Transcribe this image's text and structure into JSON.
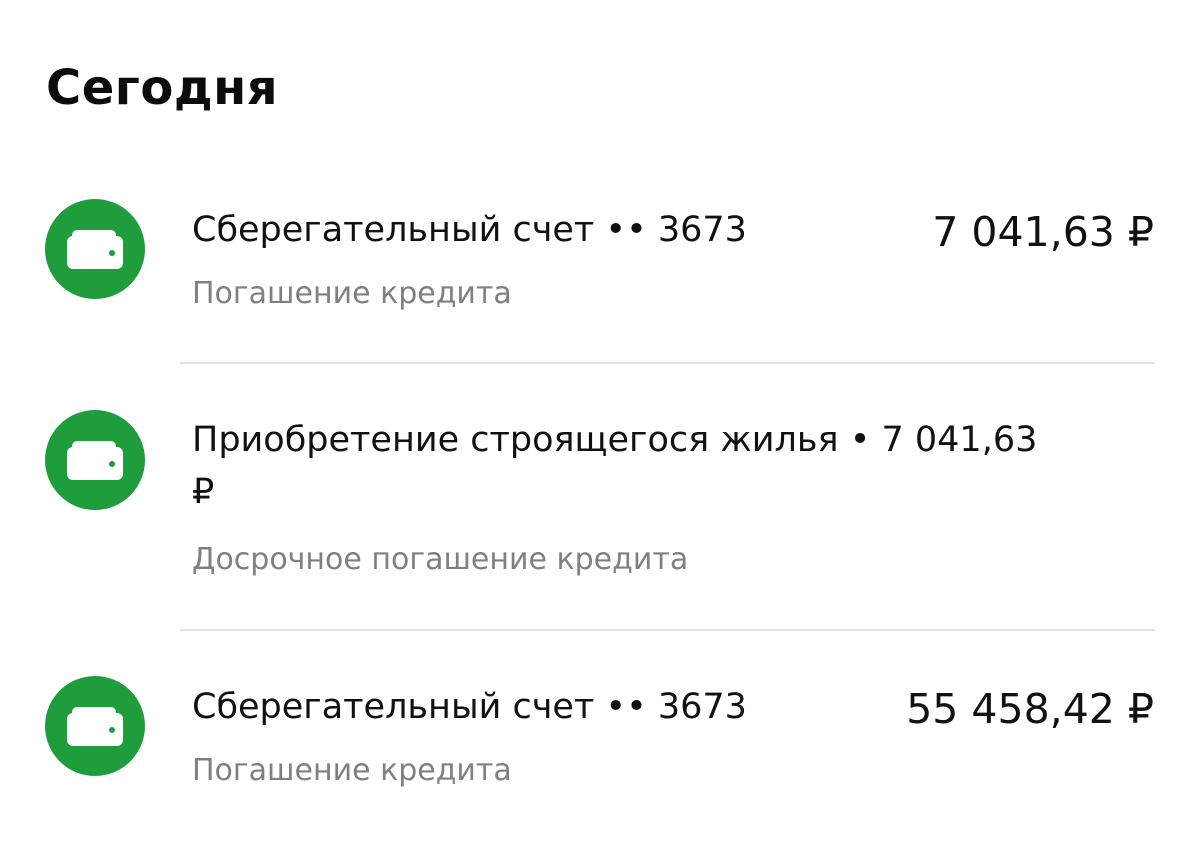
{
  "section": {
    "title": "Сегодня"
  },
  "operations": [
    {
      "icon": "wallet-icon",
      "title": "Сберегательный счет •• 3673",
      "amount": "7 041,63 ₽",
      "subtitle": "Погашение кредита"
    },
    {
      "icon": "wallet-icon",
      "title_line1": "Приобретение строящегося жилья • 7 041,63",
      "title_line2": "₽",
      "subtitle": "Досрочное погашение кредита"
    },
    {
      "icon": "wallet-icon",
      "title": "Сберегательный счет •• 3673",
      "amount": "55 458,42 ₽",
      "subtitle": "Погашение кредита"
    }
  ],
  "colors": {
    "icon_background": "#1f9d3c",
    "subtitle": "#808080",
    "divider": "#e2e2e2"
  }
}
